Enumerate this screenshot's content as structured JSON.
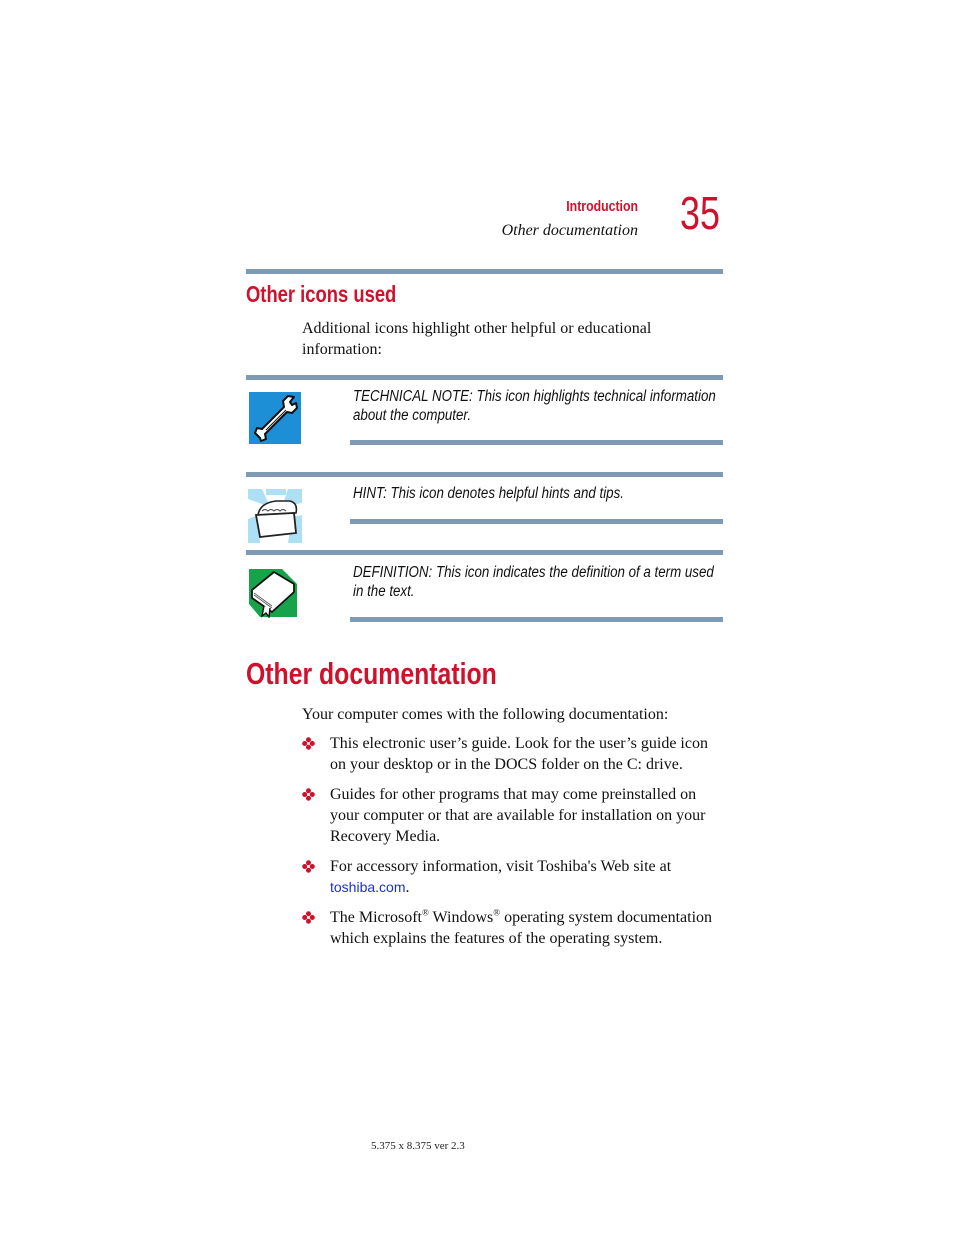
{
  "header": {
    "section": "Introduction",
    "subsection": "Other documentation",
    "page_number": "35"
  },
  "icons_section": {
    "title": "Other icons used",
    "intro": "Additional icons highlight other helpful or educational information:",
    "notes": [
      {
        "icon": "wrench-icon",
        "text": "TECHNICAL NOTE: This icon highlights technical information about the computer."
      },
      {
        "icon": "treasure-chest-icon",
        "text": "HINT: This icon denotes helpful hints and tips."
      },
      {
        "icon": "book-icon",
        "text": "DEFINITION: This icon indicates the definition of a term used in the text."
      }
    ]
  },
  "docs_section": {
    "title": "Other documentation",
    "intro": "Your computer comes with the following documentation:",
    "bullets": [
      {
        "text": "This electronic user’s guide. Look for the user’s guide icon on your desktop or in the DOCS folder on the C: drive."
      },
      {
        "text": "Guides for other programs that may come preinstalled on your computer or that are available for installation on your Recovery Media."
      },
      {
        "text": "For accessory information, visit Toshiba's Web site at ",
        "link": "toshiba.com",
        "after": "."
      },
      {
        "part1": "The Microsoft",
        "reg": "®",
        "part2": " Windows",
        "part3": " operating system documentation which explains the features of the operating system."
      }
    ]
  },
  "footer": {
    "text": "5.375 x 8.375 ver 2.3"
  },
  "colors": {
    "accent_red": "#d0112b",
    "rule_blue_gray": "#7f9ab4",
    "link_blue": "#1a2fd6"
  }
}
